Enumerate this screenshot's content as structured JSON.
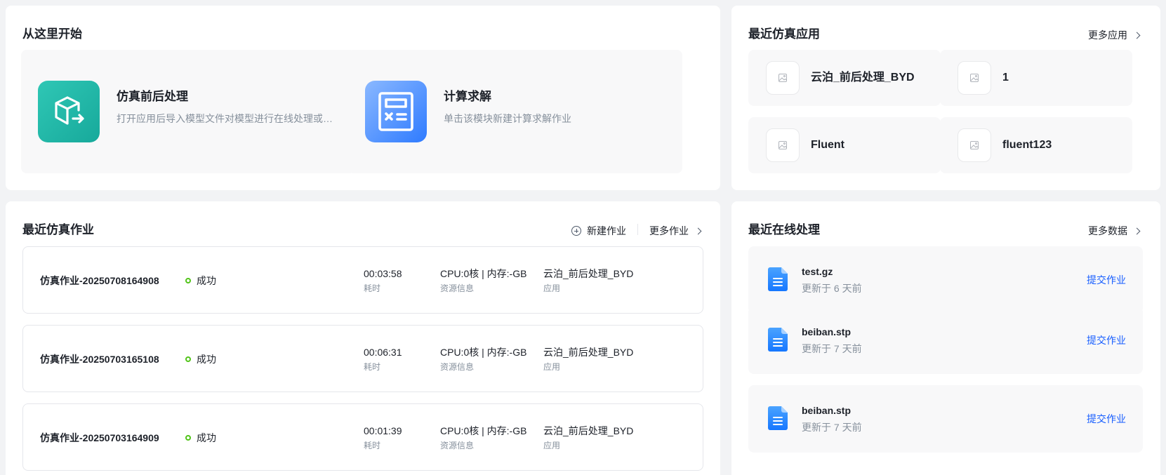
{
  "start": {
    "title": "从这里开始",
    "tiles": [
      {
        "title": "仿真前后处理",
        "desc": "打开应用后导入模型文件对模型进行在线处理或…",
        "icon": "cube-export-icon",
        "color": "#1fb3a5"
      },
      {
        "title": "计算求解",
        "desc": "单击该模块新建计算求解作业",
        "icon": "calculator-icon",
        "color": "#3a86ff"
      }
    ]
  },
  "apps": {
    "title": "最近仿真应用",
    "more": "更多应用",
    "items": [
      {
        "name": "云泊_前后处理_BYD"
      },
      {
        "name": "1"
      },
      {
        "name": "Fluent"
      },
      {
        "name": "fluent123"
      }
    ]
  },
  "jobs": {
    "title": "最近仿真作业",
    "new_job": "新建作业",
    "more": "更多作业",
    "duration_label": "耗时",
    "resource_label": "资源信息",
    "app_label": "应用",
    "rows": [
      {
        "name": "仿真作业-20250708164908",
        "status": "成功",
        "duration": "00:03:58",
        "resource": "CPU:0核 | 内存:-GB",
        "app": "云泊_前后处理_BYD"
      },
      {
        "name": "仿真作业-20250703165108",
        "status": "成功",
        "duration": "00:06:31",
        "resource": "CPU:0核 | 内存:-GB",
        "app": "云泊_前后处理_BYD"
      },
      {
        "name": "仿真作业-20250703164909",
        "status": "成功",
        "duration": "00:01:39",
        "resource": "CPU:0核 | 内存:-GB",
        "app": "云泊_前后处理_BYD"
      }
    ]
  },
  "online": {
    "title": "最近在线处理",
    "more": "更多数据",
    "action_label": "提交作业",
    "files": [
      {
        "name": "test.gz",
        "updated": "更新于 6 天前"
      },
      {
        "name": "beiban.stp",
        "updated": "更新于 7 天前"
      },
      {
        "name": "beiban.stp",
        "updated": "更新于 7 天前"
      }
    ]
  },
  "colors": {
    "accent": "#165dff",
    "success": "#52c41a",
    "tile_bg": "#f8f8f9"
  }
}
